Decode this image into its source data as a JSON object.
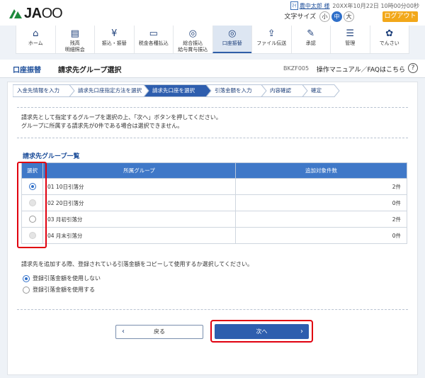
{
  "header": {
    "logo_text": "JA",
    "logo_suffix": "OO",
    "user_badge": "ﾏｲ",
    "user_name": "農中太郎 様",
    "login_time": "20XX年10月22日 10時00分00秒",
    "font_size_label": "文字サイズ",
    "font_sizes": [
      "小",
      "中",
      "大"
    ],
    "logout": "ログアウト"
  },
  "nav": [
    {
      "label": "ホーム",
      "icon": "home-icon",
      "glyph": "⌂"
    },
    {
      "label": "残高\n明細照会",
      "icon": "document-icon",
      "glyph": "▤"
    },
    {
      "label": "振込・振替",
      "icon": "yen-coin-icon",
      "glyph": "¥"
    },
    {
      "label": "税金各種払込",
      "icon": "card-icon",
      "glyph": "▭"
    },
    {
      "label": "総合振込\n給与賞与振込",
      "icon": "coins-icon",
      "glyph": "◎"
    },
    {
      "label": "口座振替",
      "icon": "coins-stack-icon",
      "glyph": "◎"
    },
    {
      "label": "ファイル伝送",
      "icon": "file-transfer-icon",
      "glyph": "⇪"
    },
    {
      "label": "承認",
      "icon": "approval-icon",
      "glyph": "✎"
    },
    {
      "label": "管理",
      "icon": "admin-icon",
      "glyph": "☰"
    },
    {
      "label": "でんさい",
      "icon": "densai-icon",
      "glyph": "✿"
    }
  ],
  "page": {
    "category": "口座振替",
    "title": "請求先グループ選択",
    "screen_code": "BKZF005",
    "help": "操作マニュアル／FAQはこちら",
    "help_icon": "?"
  },
  "steps": [
    "入金先情報を入力",
    "請求先口座指定方法を選択",
    "請求先口座を選択",
    "引落金額を入力",
    "内容確認",
    "確定"
  ],
  "instructions": [
    "請求先として指定するグループを選択の上、「次へ」ボタンを押してください。",
    "グループに所属する請求先が0件である場合は選択できません。"
  ],
  "section_title": "請求先グループ一覧",
  "table": {
    "headers": [
      "選択",
      "所属グループ",
      "追加対象件数"
    ],
    "rows": [
      {
        "group": "01 10日引落分",
        "count": "2件",
        "state": "selected"
      },
      {
        "group": "02 20日引落分",
        "count": "0件",
        "state": "disabled"
      },
      {
        "group": "03 月初引落分",
        "count": "2件",
        "state": "unselected"
      },
      {
        "group": "04 月末引落分",
        "count": "0件",
        "state": "disabled"
      }
    ]
  },
  "copy_question": "請求先を追加する際、登録されている引落金額をコピーして使用するか選択してください。",
  "copy_options": [
    {
      "label": "登録引落金額を使用しない",
      "selected": true
    },
    {
      "label": "登録引落金額を使用する",
      "selected": false
    }
  ],
  "buttons": {
    "back": "戻る",
    "next": "次へ"
  },
  "colors": {
    "accent": "#2e5eae",
    "highlight": "#e0000f",
    "logout": "#f2a81a"
  }
}
